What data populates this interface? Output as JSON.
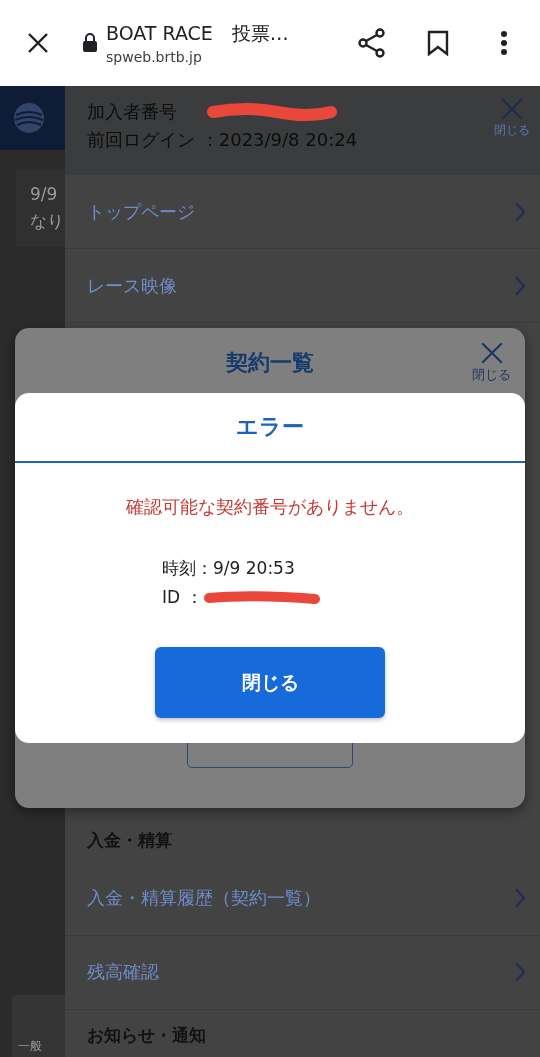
{
  "browser": {
    "title": "BOAT RACE　投票…",
    "url": "spweb.brtb.jp"
  },
  "background_page": {
    "card_lines": [
      "9/9",
      "なり"
    ],
    "tab_sub": "一般"
  },
  "side_menu": {
    "subscriber_label": "加入者番号",
    "last_login": "前回ログイン ：2023/9/8 20:24",
    "close_label": "閉じる",
    "items_top": [
      {
        "kind": "link",
        "label": "トップページ"
      },
      {
        "kind": "link",
        "label": "レース映像"
      }
    ],
    "items_bottom": [
      {
        "kind": "heading",
        "label": "入金・精算"
      },
      {
        "kind": "link",
        "label": "入金・精算履歴（契約一覧）"
      },
      {
        "kind": "link",
        "label": "残高確認"
      },
      {
        "kind": "heading",
        "label": "お知らせ・通知"
      }
    ]
  },
  "contract_modal": {
    "title": "契約一覧",
    "close_label": "閉じる"
  },
  "error_dialog": {
    "title": "エラー",
    "message": "確認可能な契約番号がありません。",
    "time": "時刻：9/9 20:53",
    "id_label": "ID ：",
    "button": "閉じる"
  }
}
